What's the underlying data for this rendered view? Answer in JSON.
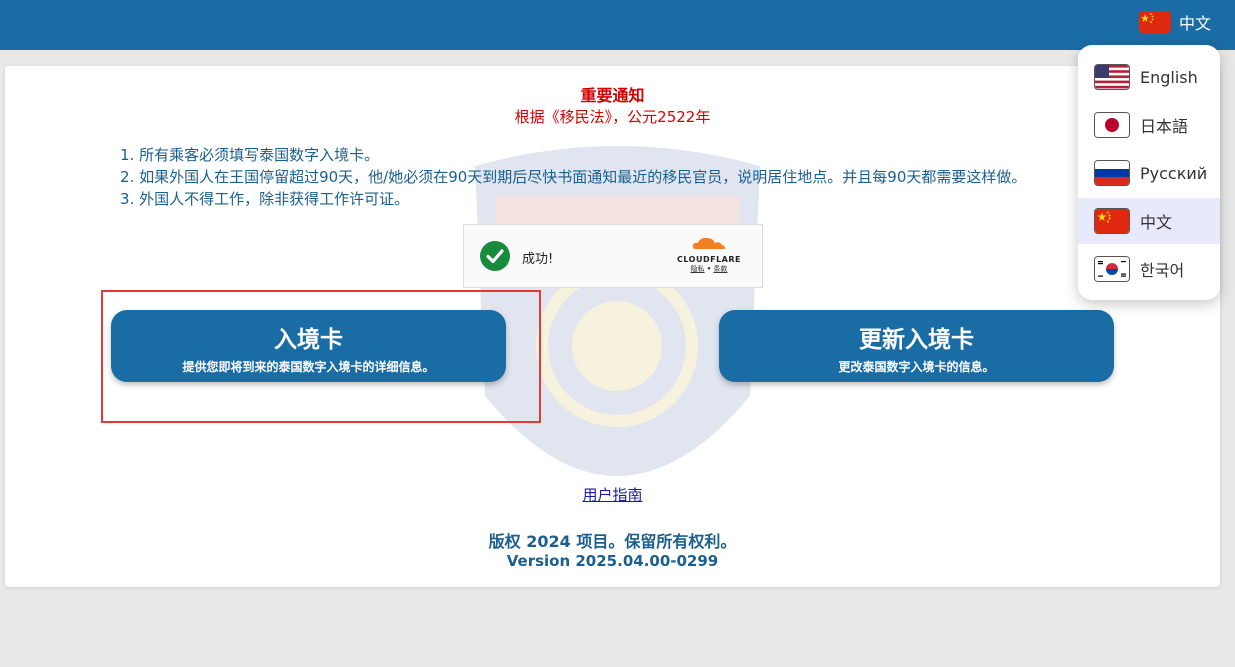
{
  "header": {
    "current_language": "中文",
    "current_flag": "china-flag-icon"
  },
  "notice": {
    "title": "重要通知",
    "subtitle": "根据《移民法》，公元2522年",
    "rules": [
      "1. 所有乘客必须填写泰国数字入境卡。",
      "2. 如果外国人在王国停留超过90天，他/她必须在90天到期后尽快书面通知最近的移民官员，说明居住地点。并且每90天都需要这样做。",
      "3. 外国人不得工作，除非获得工作许可证。"
    ]
  },
  "captcha": {
    "status": "成功!",
    "brand": "CLOUDFLARE",
    "privacy": "隐私",
    "separator": "•",
    "terms": "条款"
  },
  "actions": {
    "entry_title": "入境卡",
    "entry_desc": "提供您即将到来的泰国数字入境卡的详细信息。",
    "update_title": "更新入境卡",
    "update_desc": "更改泰国数字入境卡的信息。"
  },
  "footer": {
    "guide": "用户指南",
    "copyright": "版权 2024 项目。保留所有权利。",
    "version": "Version 2025.04.00-0299"
  },
  "languages": [
    {
      "label": "English",
      "flag": "us-flag-icon",
      "active": false
    },
    {
      "label": "日本語",
      "flag": "japan-flag-icon",
      "active": false
    },
    {
      "label": "Русский",
      "flag": "russia-flag-icon",
      "active": false
    },
    {
      "label": "中文",
      "flag": "china-flag-icon",
      "active": true
    },
    {
      "label": "한국어",
      "flag": "korea-flag-icon",
      "active": false
    }
  ],
  "colors": {
    "primary": "#1a6ca4",
    "notice_red": "#d40000",
    "text_blue": "#1a5f8f",
    "highlight": "#e53935"
  }
}
